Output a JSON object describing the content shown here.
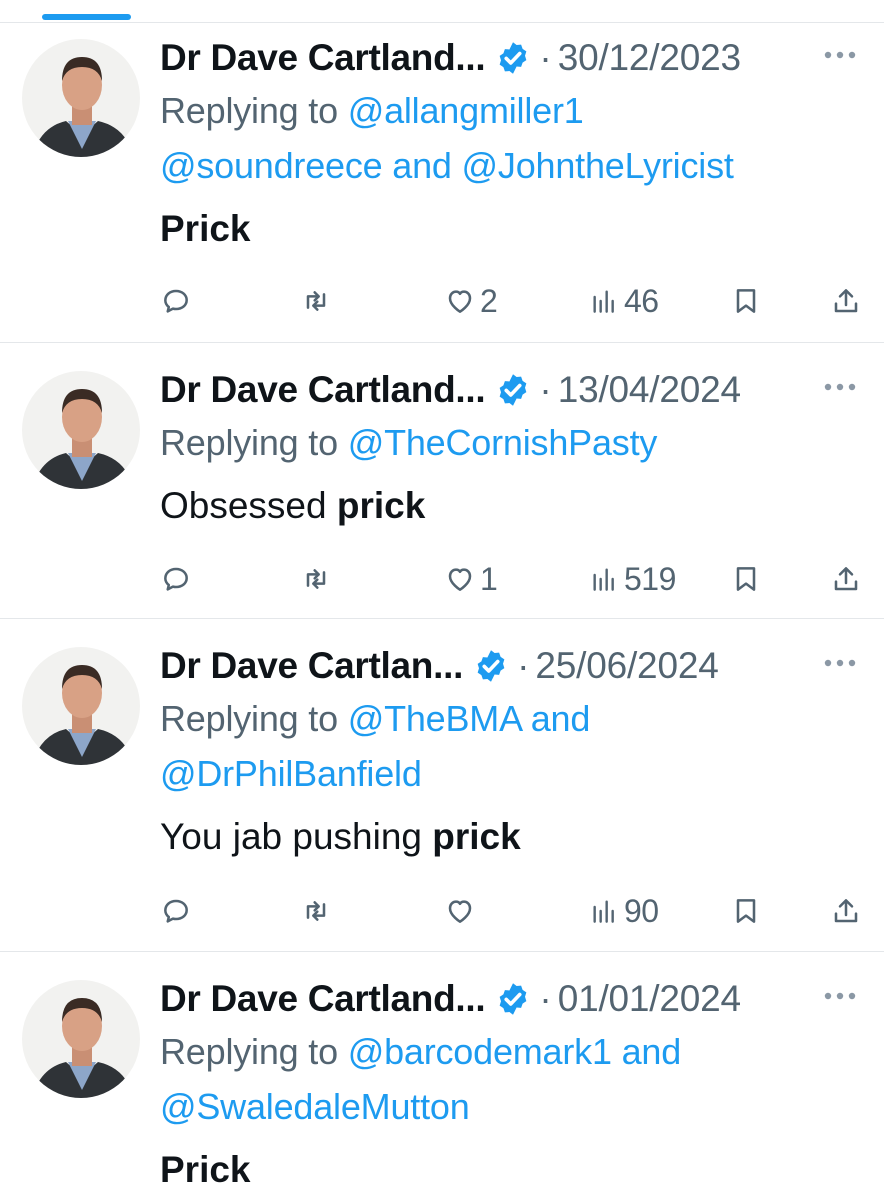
{
  "tweets": [
    {
      "name": "Dr Dave Cartland...",
      "dot": "·",
      "date": "30/12/2023",
      "reply_prefix": "Replying to",
      "reply_line1": "@allangmiller1",
      "reply_line2": "@soundreece and @JohntheLyricist",
      "text_plain": "",
      "text_bold": "Prick",
      "likes": "2",
      "views": "46"
    },
    {
      "name": "Dr Dave Cartland...",
      "dot": "·",
      "date": "13/04/2024",
      "reply_prefix": "Replying to",
      "reply_line1": "@TheCornishPasty",
      "reply_line2": "",
      "text_plain": "Obsessed ",
      "text_bold": "prick",
      "likes": "1",
      "views": "519"
    },
    {
      "name": "Dr Dave Cartlan...",
      "dot": "·",
      "date": "25/06/2024",
      "reply_prefix": "Replying to",
      "reply_line1": "@TheBMA and",
      "reply_line2": "@DrPhilBanfield",
      "text_plain": "You jab pushing ",
      "text_bold": "prick",
      "likes": "",
      "views": "90"
    },
    {
      "name": "Dr Dave Cartland...",
      "dot": "·",
      "date": "01/01/2024",
      "reply_prefix": "Replying to",
      "reply_line1": "@barcodemark1 and",
      "reply_line2": "@SwaledaleMutton",
      "text_plain": "",
      "text_bold": "Prick",
      "likes": "",
      "views": ""
    }
  ],
  "icons": {
    "verified": "verified-badge-icon",
    "more": "more-horizontal-icon",
    "reply": "reply-icon",
    "retweet": "retweet-icon",
    "like": "heart-icon",
    "views": "views-icon",
    "bookmark": "bookmark-icon",
    "share": "share-icon"
  },
  "colors": {
    "accent": "#1d9bf0",
    "secondary_text": "#536471",
    "primary_text": "#0f1419",
    "divider": "#e4e7ea"
  }
}
